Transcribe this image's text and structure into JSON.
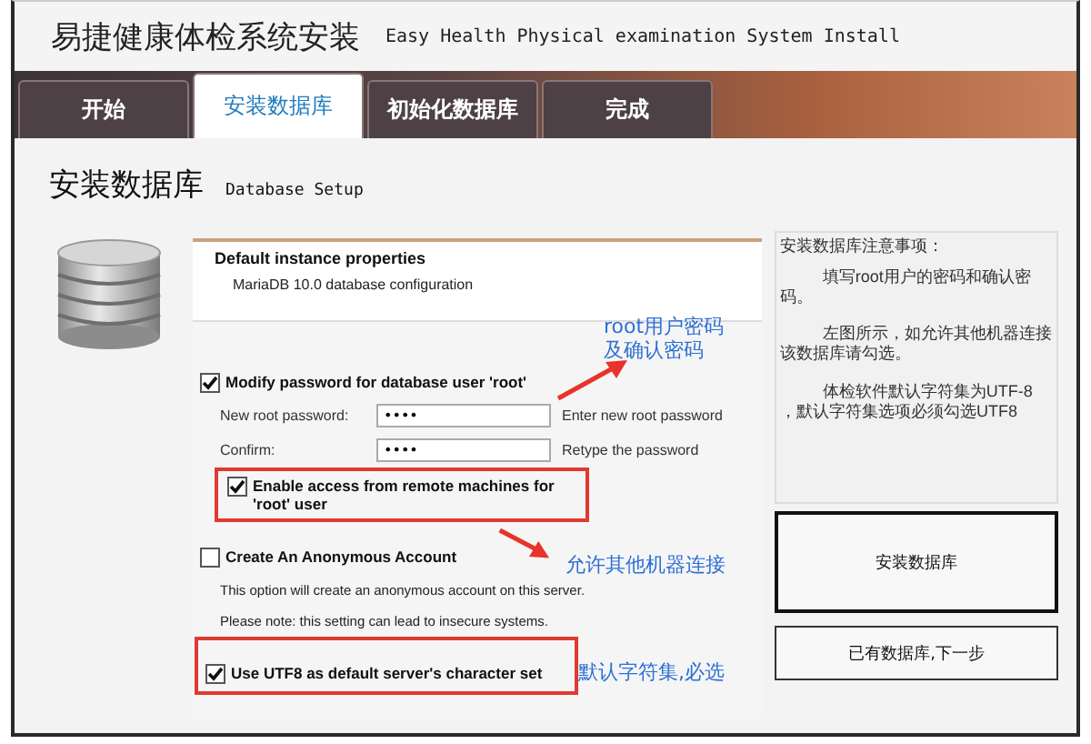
{
  "window": {
    "title": "易捷健康体检系统安装",
    "subtitle": "Easy Health Physical examination System Install"
  },
  "tabs": [
    {
      "label": "开始",
      "selected": false
    },
    {
      "label": "安装数据库",
      "selected": true
    },
    {
      "label": "初始化数据库",
      "selected": false
    },
    {
      "label": "完成",
      "selected": false
    }
  ],
  "page": {
    "title": "安装数据库",
    "subtitle": "Database Setup"
  },
  "instance": {
    "title": "Default instance properties",
    "subtitle": "MariaDB 10.0 database configuration"
  },
  "modify_password": {
    "label": "Modify password for database user 'root'",
    "checked": true
  },
  "fields": [
    {
      "label": "New root password:",
      "value": "••••",
      "hint": "Enter new root password"
    },
    {
      "label": "Confirm:",
      "value": "••••",
      "hint": "Retype the password"
    }
  ],
  "remote_access": {
    "label": "Enable access from remote machines for 'root' user",
    "checked": true
  },
  "anonymous": {
    "label": "Create An Anonymous Account",
    "checked": false,
    "notes": [
      "This option will create an anonymous account on this server.",
      "Please note: this setting can lead to insecure systems."
    ]
  },
  "utf8": {
    "label": "Use UTF8 as default server's character set",
    "checked": true
  },
  "notes": {
    "title": "安装数据库注意事项：",
    "paragraphs": [
      "填写root用户的密码和确认密码。",
      "左图所示，如允许其他机器连接该数据库请勾选。",
      "体检软件默认字符集为UTF-8 ，默认字符集选项必须勾选UTF8"
    ]
  },
  "buttons": [
    {
      "label": "安装数据库",
      "kind": "primary"
    },
    {
      "label": "已有数据库,下一步",
      "kind": "secondary"
    }
  ],
  "annotations": [
    {
      "lines": [
        "root用户密码",
        "及确认密码"
      ]
    },
    {
      "lines": [
        "允许其他机器连接"
      ]
    },
    {
      "lines": [
        "默认字符集,必选"
      ]
    }
  ]
}
